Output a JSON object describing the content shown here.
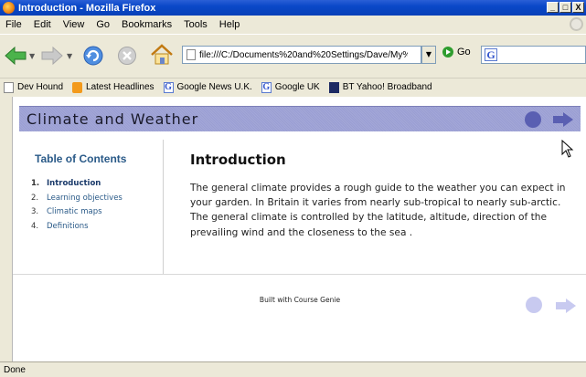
{
  "window": {
    "title": "Introduction - Mozilla Firefox",
    "controls": [
      "_",
      "□",
      "X"
    ]
  },
  "menu": {
    "items": [
      "File",
      "Edit",
      "View",
      "Go",
      "Bookmarks",
      "Tools",
      "Help"
    ]
  },
  "navigation": {
    "url": "file:///C:/Documents%20and%20Settings/Dave/My%",
    "go_label": "Go",
    "search_engine_icon": "G"
  },
  "bookmarks": [
    {
      "label": "Dev Hound",
      "icon": "page-icon"
    },
    {
      "label": "Latest Headlines",
      "icon": "rss-icon"
    },
    {
      "label": "Google News U.K.",
      "icon": "google-icon"
    },
    {
      "label": "Google UK",
      "icon": "google-icon"
    },
    {
      "label": "BT Yahoo! Broadband",
      "icon": "bt-icon"
    }
  ],
  "page": {
    "banner_title": "Climate and Weather",
    "toc": {
      "title": "Table of Contents",
      "items": [
        {
          "num": "1.",
          "label": "Introduction",
          "active": true
        },
        {
          "num": "2.",
          "label": "Learning objectives",
          "active": false
        },
        {
          "num": "3.",
          "label": "Climatic maps",
          "active": false
        },
        {
          "num": "4.",
          "label": "Definitions",
          "active": false
        }
      ]
    },
    "content": {
      "heading": "Introduction",
      "body": "The general climate provides a rough guide to the weather you can expect in your garden. In Britain it varies from nearly sub-tropical to nearly sub-arctic. The general climate is controlled by the latitude, altitude, direction of the prevailing wind and the closeness to the sea ."
    },
    "footer": "Built with Course Genie"
  },
  "status": {
    "text": "Done"
  },
  "colors": {
    "titlebar": "#0a48c8",
    "banner": "#a3a7d8",
    "toc_link": "#2a5a88",
    "nav_circle": "#5a5fb2",
    "nav_arrow": "#5a5fb2"
  }
}
